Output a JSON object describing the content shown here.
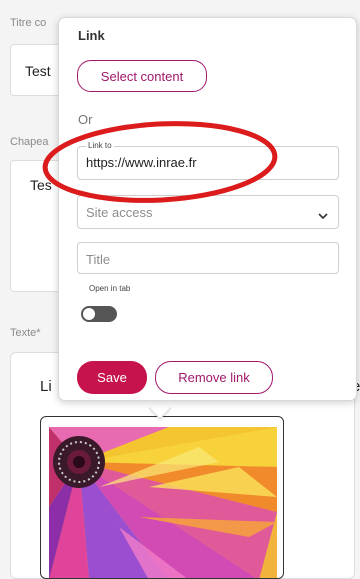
{
  "background_form": {
    "titre_label": "Titre co",
    "titre_value": "Test",
    "chapeau_label": "Chapea",
    "chapeau_value": "Tes",
    "texte_label": "Texte*",
    "texte_start": "Li",
    "texte_edge": "e"
  },
  "popup": {
    "title": "Link",
    "select_content_label": "Select content",
    "or_label": "Or",
    "link_field": {
      "legend": "Link to",
      "value": "https://www.inrae.fr"
    },
    "site_access": {
      "placeholder": "Site access",
      "icon": "chevron-down-icon"
    },
    "title_field": {
      "placeholder": "Title"
    },
    "open_in_tab": {
      "label": "Open in tab",
      "checked": false
    },
    "save_label": "Save",
    "remove_link_label": "Remove link"
  },
  "colors": {
    "accent": "#a0196a",
    "save_button": "#c6134b",
    "annotation_ring": "#dc1c1c",
    "toggle_off": "#555555"
  }
}
